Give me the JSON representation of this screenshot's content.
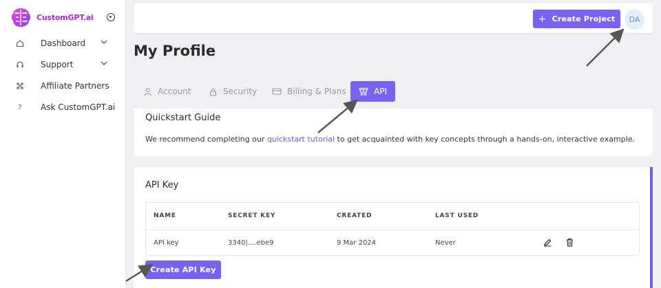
{
  "brand": {
    "name": "CustomGPT.ai",
    "logo_icon": "brain-logo-icon"
  },
  "sidebar": {
    "items": [
      {
        "label": "Dashboard",
        "icon": "home-icon",
        "has_chevron": true
      },
      {
        "label": "Support",
        "icon": "headset-icon",
        "has_chevron": true
      },
      {
        "label": "Affiliate Partners",
        "icon": "network-icon",
        "has_chevron": false
      },
      {
        "label": "Ask CustomGPT.ai",
        "icon": "question-icon",
        "has_chevron": false
      }
    ]
  },
  "header": {
    "create_project_label": "Create Project",
    "avatar_initials": "DA"
  },
  "page": {
    "title": "My Profile"
  },
  "tabs": [
    {
      "label": "Account",
      "icon": "user-icon",
      "active": false
    },
    {
      "label": "Security",
      "icon": "lock-icon",
      "active": false
    },
    {
      "label": "Billing & Plans",
      "icon": "card-icon",
      "active": false
    },
    {
      "label": "API",
      "icon": "api-icon",
      "active": true
    }
  ],
  "quickstart": {
    "title": "Quickstart Guide",
    "text_before": "We recommend completing our ",
    "link_text": "quickstart tutorial",
    "text_after": " to get acquainted with key concepts through a hands-on, interactive example."
  },
  "api_keys": {
    "title": "API Key",
    "columns": [
      "NAME",
      "SECRET KEY",
      "CREATED",
      "LAST USED"
    ],
    "rows": [
      {
        "name": "API key",
        "secret": "3340|....ebe9",
        "created": "9 Mar 2024",
        "last_used": "Never"
      }
    ],
    "create_label": "Create API Key"
  },
  "colors": {
    "accent": "#7a62f0",
    "brand": "#b324d6",
    "link": "#6c5ce7"
  }
}
